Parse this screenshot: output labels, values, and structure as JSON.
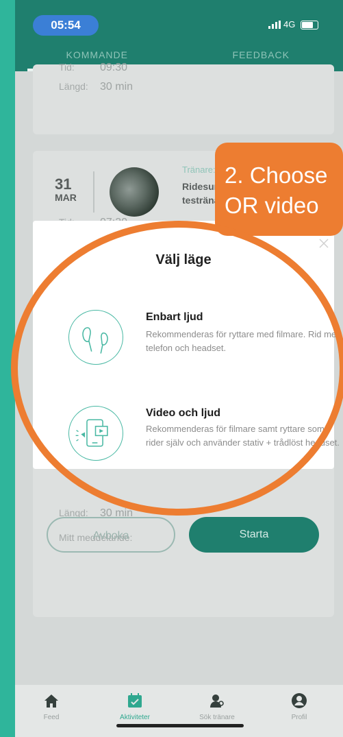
{
  "status_bar": {
    "time": "05:54",
    "network": "4G"
  },
  "tabs": [
    {
      "label": "KOMMANDE",
      "active": true
    },
    {
      "label": "FEEDBACK",
      "active": false
    }
  ],
  "card1": {
    "time_label": "Tid:",
    "time_value": "09:30",
    "length_label": "Längd:",
    "length_value": "30 min"
  },
  "card2": {
    "day": "31",
    "month": "MAR",
    "trainer_label": "Tränare:",
    "trainer_name_line1": "Ridesum",
    "trainer_name_line2": "testränar",
    "time_label": "Tid:",
    "time_value": "07:30",
    "length_label": "Längd:",
    "length_value": "30 min",
    "message_label": "Mitt meddelande:",
    "cancel_label": "Avboka",
    "start_label": "Starta"
  },
  "modal": {
    "title": "Välj läge",
    "options": [
      {
        "title": "Enbart ljud",
        "desc": "Rekommenderas för ryttare med filmare. Rid med telefon och headset.",
        "icon": "earphones-icon"
      },
      {
        "title": "Video och ljud",
        "desc": "Rekommenderas för filmare samt ryttare som rider själv och använder stativ + trådlöst headset.",
        "icon": "phone-video-icon"
      }
    ]
  },
  "callout": {
    "text": "2. Choose\nOR video"
  },
  "nav": [
    {
      "label": "Feed",
      "icon": "home-icon",
      "active": false
    },
    {
      "label": "Aktiviteter",
      "icon": "calendar-check-icon",
      "active": true
    },
    {
      "label": "Sök tränare",
      "icon": "search-trainer-icon",
      "active": false
    },
    {
      "label": "Profil",
      "icon": "profile-icon",
      "active": false
    }
  ],
  "colors": {
    "brand": "#1f7f6e",
    "accent": "#2fb59b",
    "annotation": "#ed7d31"
  }
}
